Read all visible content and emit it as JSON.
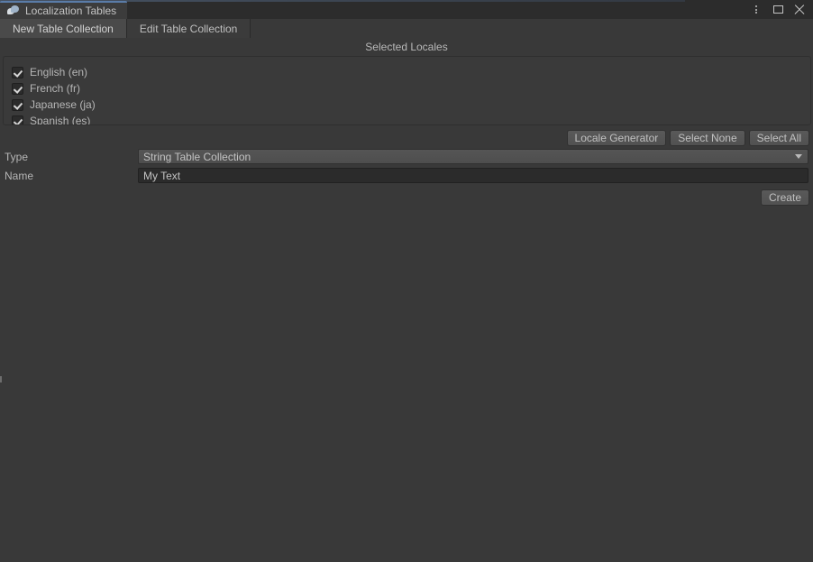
{
  "window": {
    "tab_title": "Localization Tables",
    "tab_icon": "localization-bubbles-icon",
    "controls": {
      "menu_label": "⋮",
      "menu_icon": "kebab-menu-icon",
      "maximize_icon": "maximize-icon",
      "close_icon": "close-icon"
    }
  },
  "toolbar": {
    "tabs": [
      {
        "label": "New Table Collection",
        "active": true
      },
      {
        "label": "Edit Table Collection",
        "active": false
      }
    ]
  },
  "locales": {
    "header": "Selected Locales",
    "items": [
      {
        "label": "English (en)",
        "checked": true
      },
      {
        "label": "French (fr)",
        "checked": true
      },
      {
        "label": "Japanese (ja)",
        "checked": true
      },
      {
        "label": "Spanish (es)",
        "checked": true
      }
    ],
    "buttons": [
      {
        "label": "Locale Generator"
      },
      {
        "label": "Select None"
      },
      {
        "label": "Select All"
      }
    ]
  },
  "form": {
    "type": {
      "label": "Type",
      "value": "String Table Collection",
      "icon": "chevron-down-icon"
    },
    "name": {
      "label": "Name",
      "value": "My Text",
      "placeholder": ""
    },
    "create_button": "Create"
  },
  "colors": {
    "window_background": "#393939",
    "titlebar": "#2c2c2c",
    "tab_accent": "#5a7ca8",
    "active_tab": "#4a4a4a",
    "button_face": "#555555",
    "text": "#b6b6b6",
    "field_dark": "#2b2b2b"
  }
}
